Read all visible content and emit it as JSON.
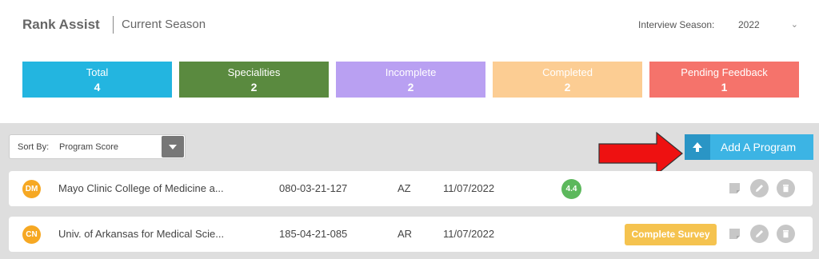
{
  "header": {
    "app_title": "Rank Assist",
    "subtitle": "Current Season",
    "season_label": "Interview Season:",
    "season_value": "2022"
  },
  "stats": [
    {
      "label": "Total",
      "value": "4",
      "color": "#23b5e0"
    },
    {
      "label": "Specialities",
      "value": "2",
      "color": "#5a8a3f"
    },
    {
      "label": "Incomplete",
      "value": "2",
      "color": "#b9a0f2"
    },
    {
      "label": "Completed",
      "value": "2",
      "color": "#fccd93"
    },
    {
      "label": "Pending Feedback",
      "value": "1",
      "color": "#f5736b"
    }
  ],
  "sort": {
    "label": "Sort By:",
    "value": "Program Score"
  },
  "add_button": {
    "label": "Add A Program"
  },
  "rows": [
    {
      "initials": "DM",
      "name": "Mayo Clinic College of Medicine a...",
      "code": "080-03-21-127",
      "state": "AZ",
      "date": "11/07/2022",
      "score": "4.4"
    },
    {
      "initials": "CN",
      "name": "Univ. of Arkansas for Medical Scie...",
      "code": "185-04-21-085",
      "state": "AR",
      "date": "11/07/2022",
      "action": "Complete Survey"
    }
  ]
}
